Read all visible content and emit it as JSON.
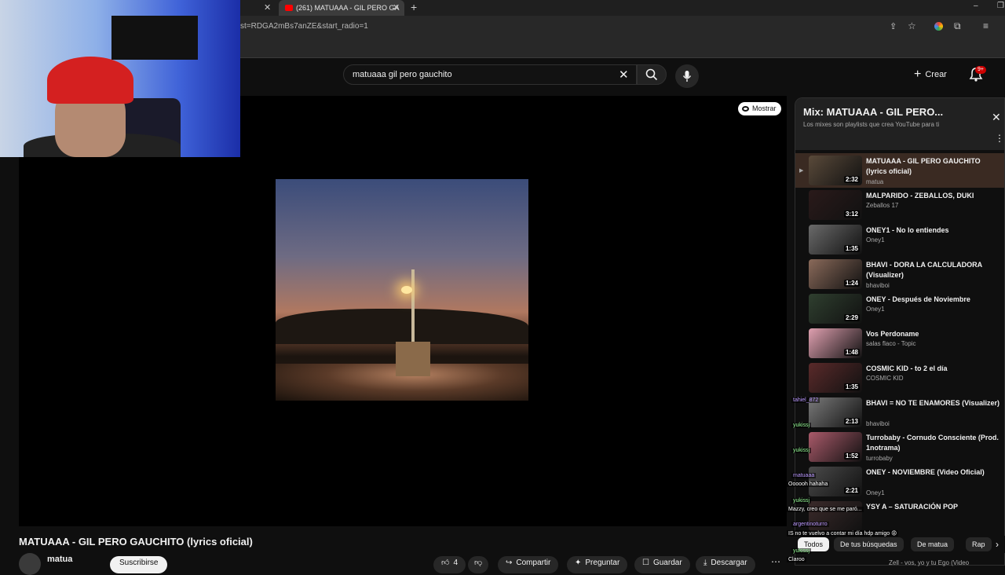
{
  "browser": {
    "tab_title": "(261) MATUAAA - GIL PERO GA",
    "url_fragment": "st=RDGA2mBs7anZE&start_radio=1"
  },
  "header": {
    "search_value": "matuaaa gil pero gauchito",
    "create_label": "Crear",
    "notifications_badge": "9+"
  },
  "player": {
    "show_label": "Mostrar"
  },
  "video": {
    "title": "MATUAAA - GIL PERO GAUCHITO (lyrics oficial)",
    "channel": "matua",
    "subscribe_label": "Suscribirse",
    "likes": "4",
    "actions": {
      "share": "Compartir",
      "ask": "Preguntar",
      "save": "Guardar",
      "download": "Descargar"
    }
  },
  "mix": {
    "title": "Mix: MATUAAA - GIL PERO...",
    "subtitle": "Los mixes son playlists que crea YouTube para ti",
    "items": [
      {
        "title": "MATUAAA - GIL PERO GAUCHITO (lyrics oficial)",
        "channel": "matua",
        "duration": "2:32",
        "active": true
      },
      {
        "title": "MALPARIDO - ZEBALLOS, DUKI",
        "channel": "Zeballos 17",
        "duration": "3:12"
      },
      {
        "title": "ONEY1 - No lo entiendes",
        "channel": "Oney1",
        "duration": "1:35"
      },
      {
        "title": "BHAVI - DORA LA CALCULADORA (Visualizer)",
        "channel": "bhaviboi",
        "duration": "1:24"
      },
      {
        "title": "ONEY - Después de Noviembre",
        "channel": "Oney1",
        "duration": "2:29"
      },
      {
        "title": "Vos Perdoname",
        "channel": "salas flaco - Topic",
        "duration": "1:48"
      },
      {
        "title": "COSMIC KID - to 2 el día",
        "channel": "COSMIC KID",
        "duration": "1:35"
      },
      {
        "title": "BHAVI = NO TE ENAMORES (Visualizer)",
        "channel": "bhaviboi",
        "duration": "2:13"
      },
      {
        "title": "Turrobaby - Cornudo Consciente (Prod. 1notrama)",
        "channel": "turrobaby",
        "duration": "1:52"
      },
      {
        "title": "ONEY - NOVIEMBRE (Video Oficial)",
        "channel": "Oney1",
        "duration": "2:21"
      },
      {
        "title": "YSY A – SATURACIÓN POP",
        "channel": "",
        "duration": ""
      }
    ]
  },
  "chips": [
    "Todos",
    "De tus búsquedas",
    "De matua",
    "Rap"
  ],
  "partial_next": "Zell - vos, yo y tu Ego (Video",
  "chat": [
    {
      "user": "tahiel_872",
      "msg": ""
    },
    {
      "user": "yukissj",
      "msg": ""
    },
    {
      "user": "yukissj",
      "msg": ""
    },
    {
      "user": "matuaaa",
      "msg": "Oooooh hahaha"
    },
    {
      "user": "yukissj",
      "msg": "Mazzy, creo que se me paró..."
    },
    {
      "user": "argentinoturro",
      "msg": "IS no te vuelvo a contar mi día hdp amigo 😡"
    },
    {
      "user": "yukissj",
      "msg": "Claroo"
    }
  ],
  "colors": {
    "accent": "#ff0000",
    "active_row": "#3a2a22",
    "bg": "#0f0f0f"
  }
}
